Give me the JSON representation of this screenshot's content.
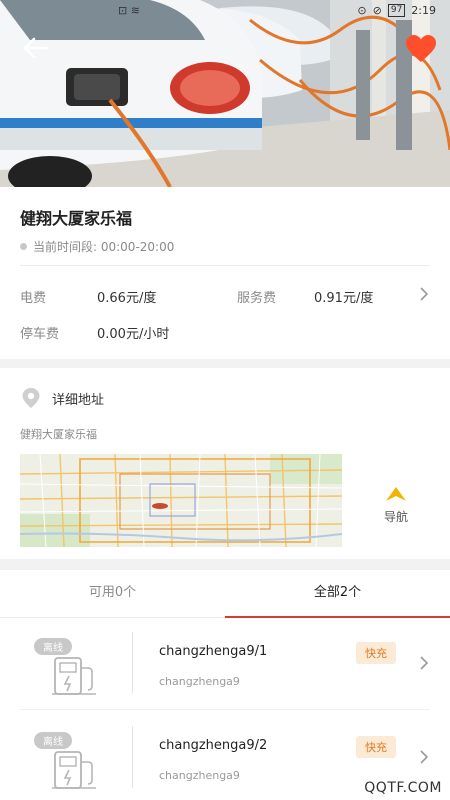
{
  "status_bar": {
    "left_icons": "⊡ ≋",
    "time": "2:19",
    "battery": "97"
  },
  "station": {
    "name": "健翔大厦家乐福",
    "time_label": "当前时间段: 00:00-20:00"
  },
  "fees": {
    "electricity_label": "电费",
    "electricity_value": "0.66元/度",
    "service_label": "服务费",
    "service_value": "0.91元/度",
    "parking_label": "停车费",
    "parking_value": "0.00元/小时"
  },
  "address": {
    "title": "详细地址",
    "detail": "健翔大厦家乐福",
    "nav_label": "导航"
  },
  "tabs": [
    {
      "label": "可用0个"
    },
    {
      "label": "全部2个"
    }
  ],
  "chargers": [
    {
      "status": "离线",
      "name": "changzhenga9/1",
      "sub": "changzhenga9",
      "type": "快充"
    },
    {
      "status": "离线",
      "name": "changzhenga9/2",
      "sub": "changzhenga9",
      "type": "快充"
    }
  ],
  "watermark": "QQTF.COM",
  "colors": {
    "accent_red": "#d63b35",
    "fast_orange": "#e07b21",
    "nav_yellow": "#f3b400",
    "heart": "#ff4e2c"
  }
}
